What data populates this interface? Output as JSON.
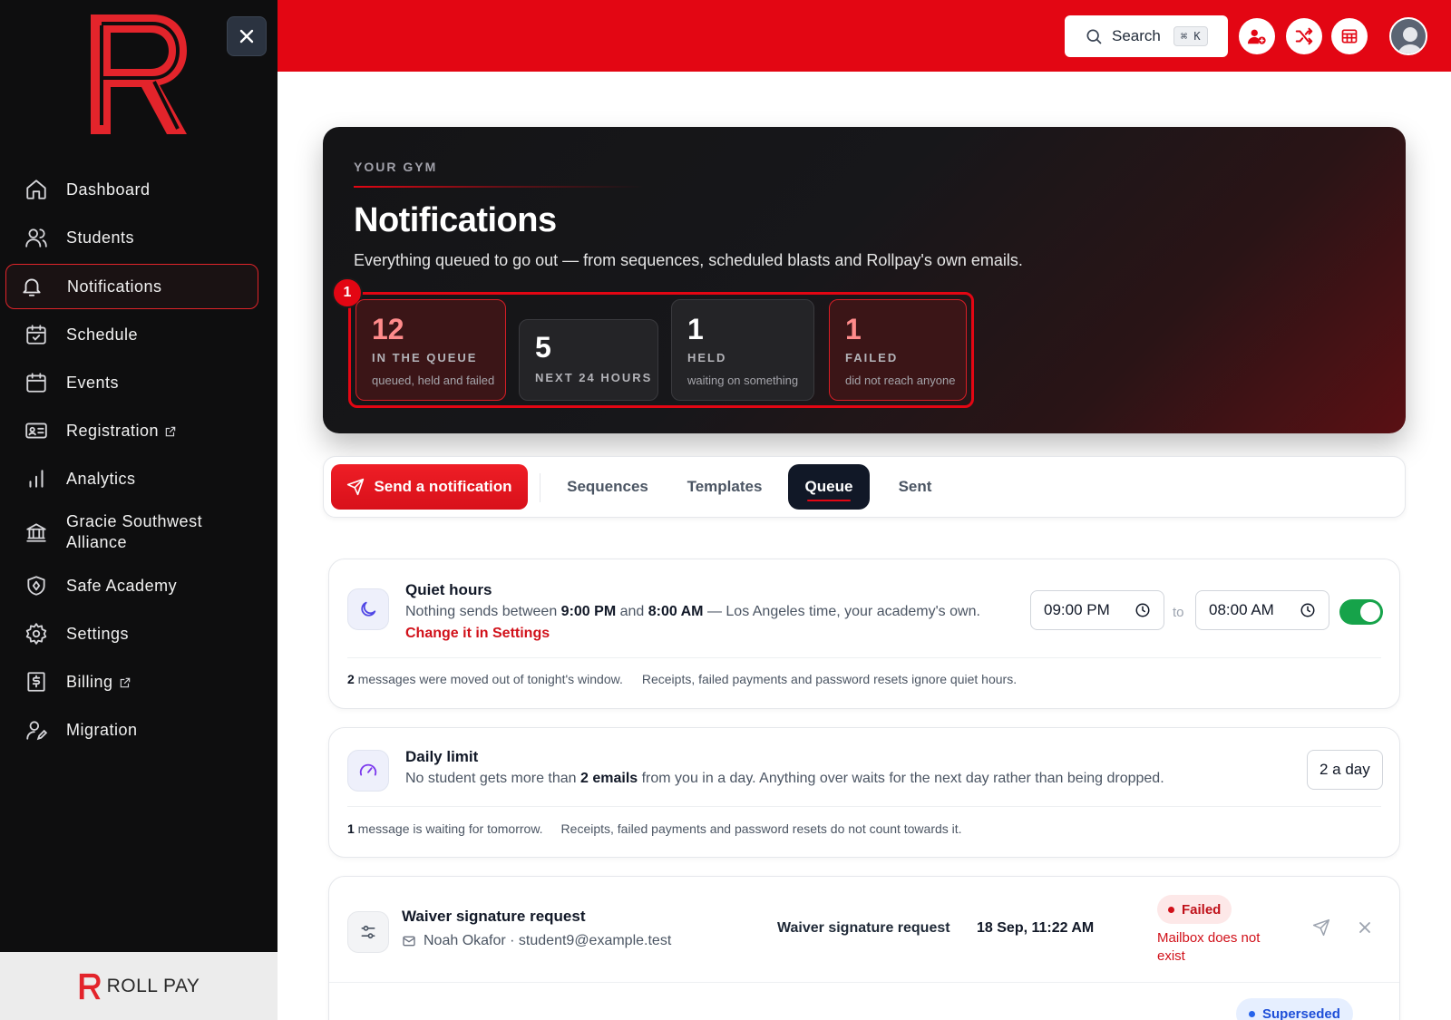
{
  "brand": {
    "footer_name": "ROLL PAY",
    "accent": "#e30613"
  },
  "sidebar": {
    "items": [
      {
        "label": "Dashboard",
        "icon": "home-icon"
      },
      {
        "label": "Students",
        "icon": "users-icon"
      },
      {
        "label": "Notifications",
        "icon": "bell-icon",
        "active": true
      },
      {
        "label": "Schedule",
        "icon": "calendar-check-icon"
      },
      {
        "label": "Events",
        "icon": "calendar-icon"
      },
      {
        "label": "Registration",
        "icon": "id-card-icon",
        "external": true
      },
      {
        "label": "Analytics",
        "icon": "bar-chart-icon"
      },
      {
        "label": "Gracie Southwest",
        "label2": "Alliance",
        "icon": "bank-icon"
      },
      {
        "label": "Safe Academy",
        "icon": "shield-icon"
      },
      {
        "label": "Settings",
        "icon": "gear-icon"
      },
      {
        "label": "Billing",
        "icon": "dollar-icon",
        "external": true
      },
      {
        "label": "Migration",
        "icon": "user-edit-icon"
      }
    ]
  },
  "topbar": {
    "search_label": "Search",
    "search_shortcut": "⌘ K"
  },
  "hero": {
    "eyebrow": "YOUR GYM",
    "title": "Notifications",
    "subtitle": "Everything queued to go out — from sequences, scheduled blasts and Rollpay's own emails.",
    "badge": "1",
    "stats": [
      {
        "value": "12",
        "label": "IN THE QUEUE",
        "desc": "queued, held and failed"
      },
      {
        "value": "5",
        "label": "NEXT 24 HOURS",
        "desc": ""
      },
      {
        "value": "1",
        "label": "HELD",
        "desc": "waiting on something"
      },
      {
        "value": "1",
        "label": "FAILED",
        "desc": "did not reach anyone"
      }
    ]
  },
  "tabs": {
    "send_label": "Send a notification",
    "items": [
      "Sequences",
      "Templates",
      "Queue",
      "Sent"
    ],
    "active": "Queue"
  },
  "quiet_hours": {
    "title": "Quiet hours",
    "text_pre": "Nothing sends between ",
    "from_bold": "9:00 PM",
    "text_mid": " and ",
    "to_bold": "8:00 AM",
    "text_post": " — Los Angeles time, your academy's own.",
    "link": "Change it in Settings",
    "from_value": "09:00 PM",
    "to_label": "to",
    "to_value": "08:00 AM",
    "enabled": true,
    "note_count": "2",
    "note_text": " messages were moved out of tonight's window.",
    "note_extra": "Receipts, failed payments and password resets ignore quiet hours."
  },
  "daily_limit": {
    "title": "Daily limit",
    "text_pre": "No student gets more than ",
    "bold": "2 emails",
    "text_post": " from you in a day. Anything over waits for the next day rather than being dropped.",
    "select_value": "2 a day",
    "note_count": "1",
    "note_text": " message is waiting for tomorrow.",
    "note_extra": "Receipts, failed payments and password resets do not count towards it."
  },
  "queue": {
    "rows": [
      {
        "title": "Waiver signature request",
        "recipient": "Noah Okafor · student9@example.test",
        "template": "Waiver signature request",
        "date": "18 Sep, 11:22 AM",
        "status": "Failed",
        "status_color": "#d1111a",
        "reason": "Mailbox does not exist"
      }
    ],
    "next_status": "Superseded",
    "next_status_color": "#1d4ed8"
  }
}
